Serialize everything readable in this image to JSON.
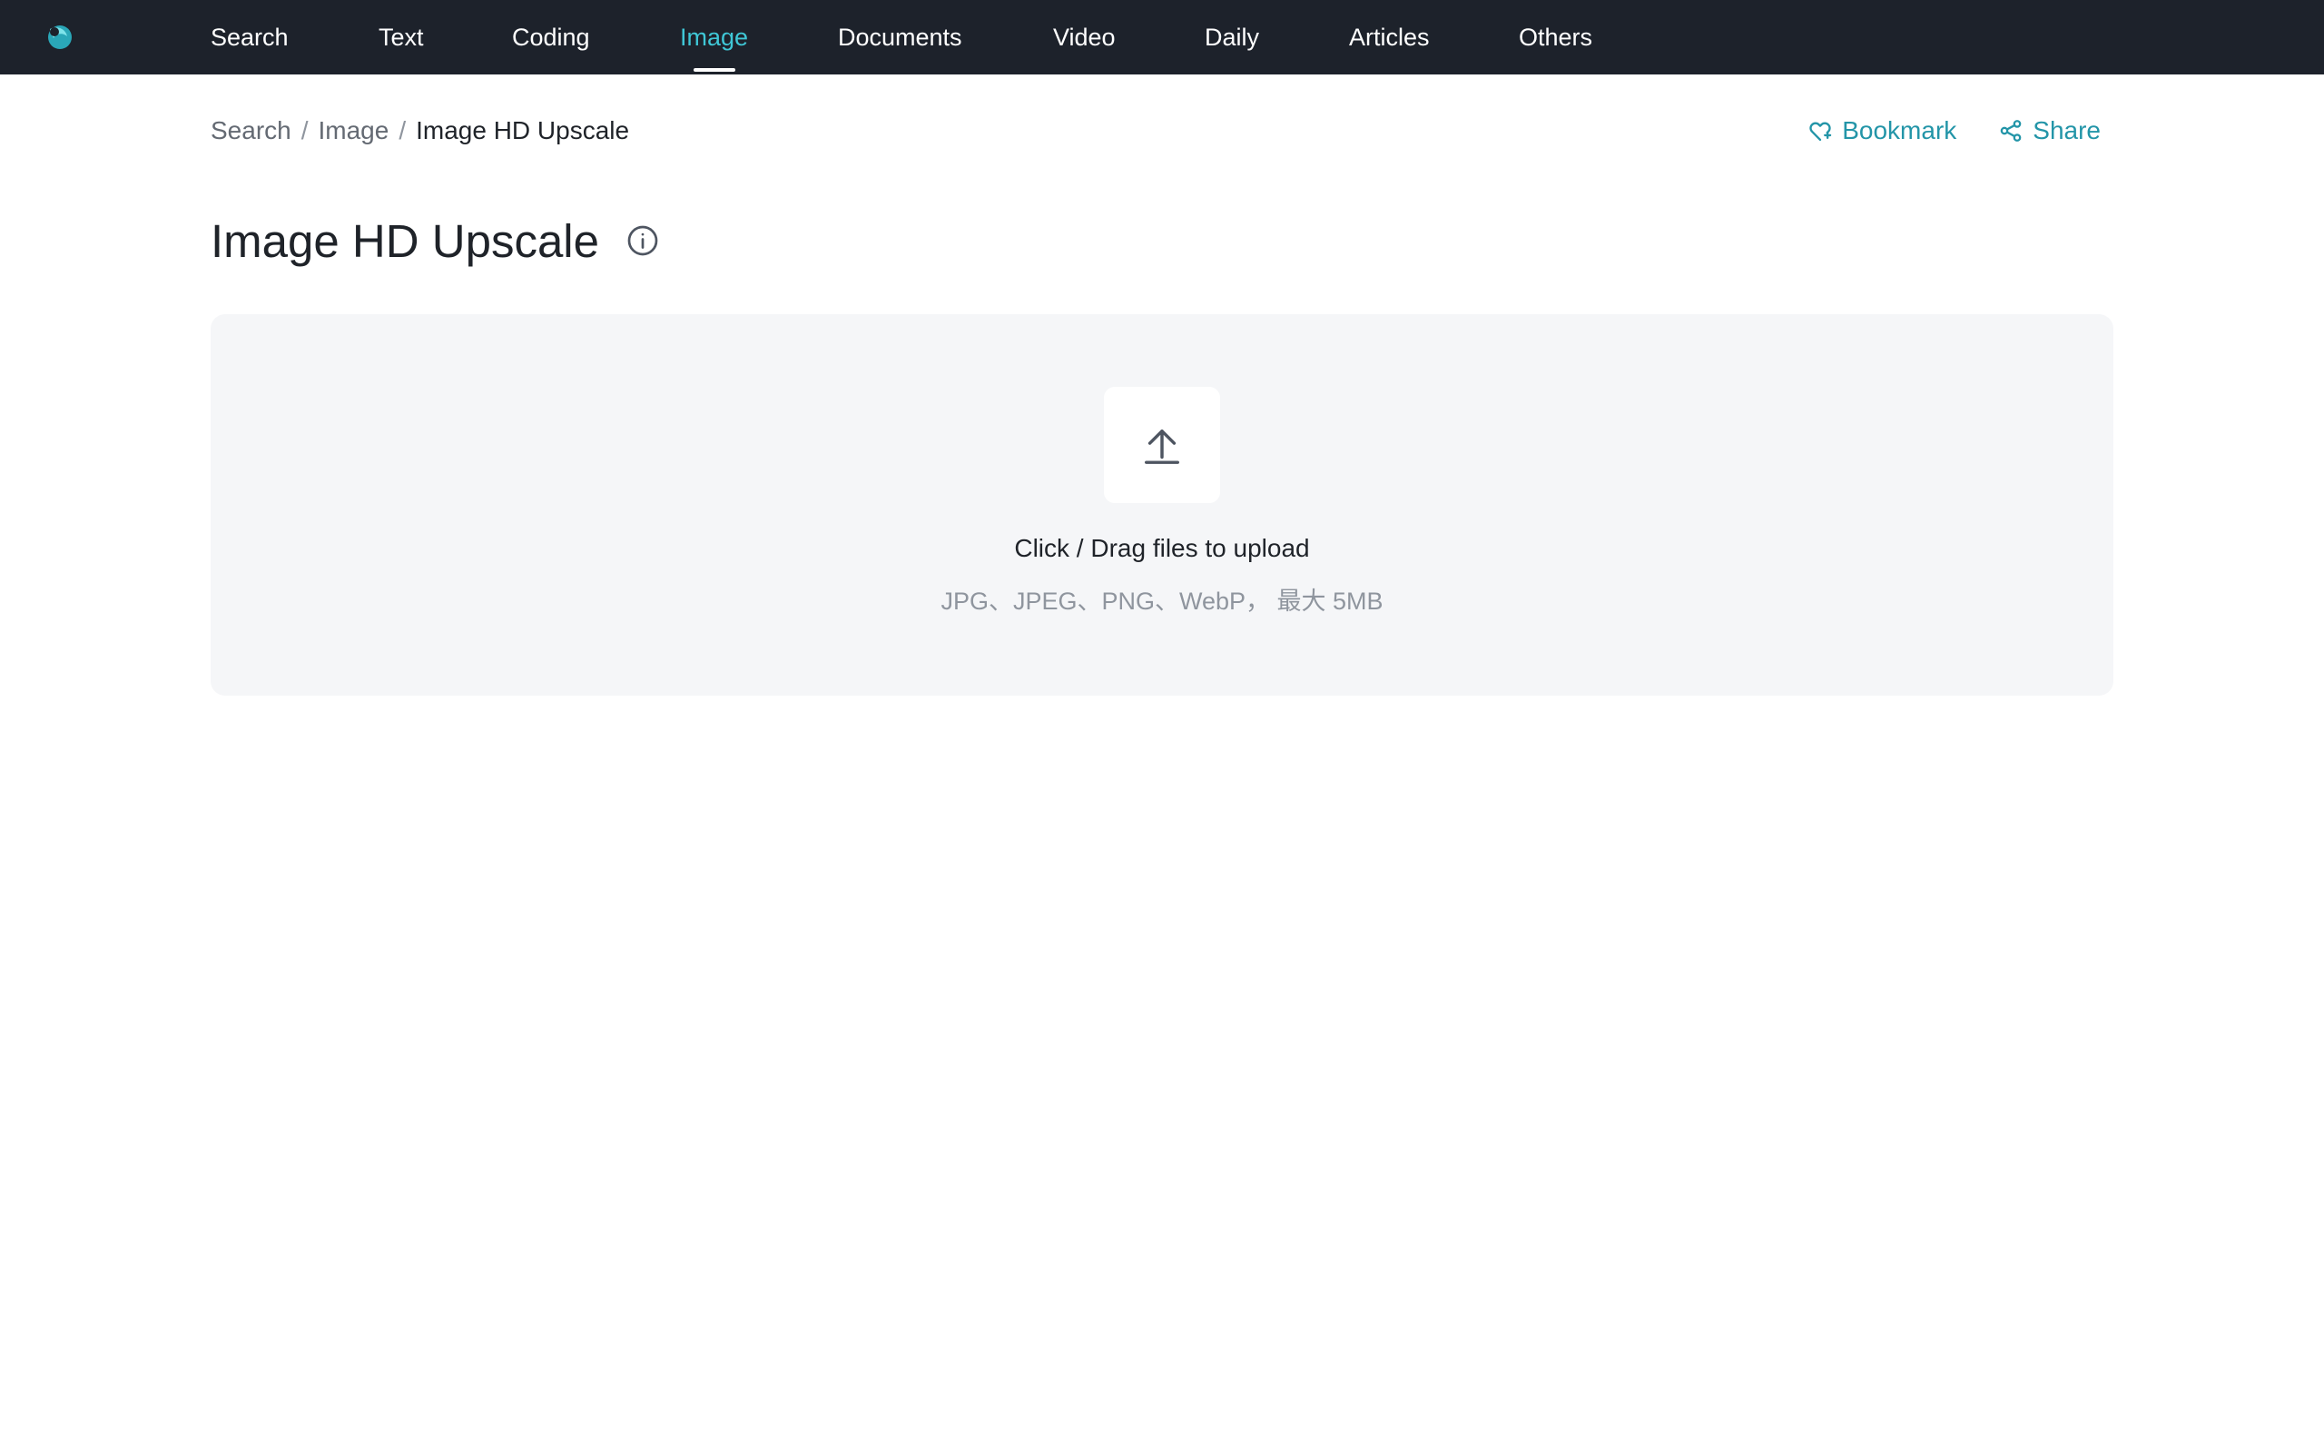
{
  "nav": {
    "logo_icon": "brand-logo-icon",
    "items": [
      {
        "label": "Search"
      },
      {
        "label": "Text"
      },
      {
        "label": "Coding"
      },
      {
        "label": "Image"
      },
      {
        "label": "Documents"
      },
      {
        "label": "Video"
      },
      {
        "label": "Daily"
      },
      {
        "label": "Articles"
      },
      {
        "label": "Others"
      }
    ],
    "active": "Image",
    "background": "#1d222b",
    "active_color": "#3fc7d6"
  },
  "breadcrumb": {
    "items": [
      {
        "label": "Search"
      },
      {
        "label": "Image"
      },
      {
        "label": "Image HD Upscale"
      }
    ],
    "separator": "/"
  },
  "actions": {
    "bookmark_label": "Bookmark",
    "bookmark_icon": "heart-icon",
    "share_label": "Share",
    "share_icon": "share-icon",
    "accent": "#2395a8"
  },
  "page": {
    "title": "Image HD Upscale",
    "info_icon": "info-icon"
  },
  "upload": {
    "icon": "upload-icon",
    "main_text": "Click / Drag files to upload",
    "hint_text": "JPG、JPEG、PNG、WebP， 最大 5MB",
    "background": "#f5f6f8"
  }
}
